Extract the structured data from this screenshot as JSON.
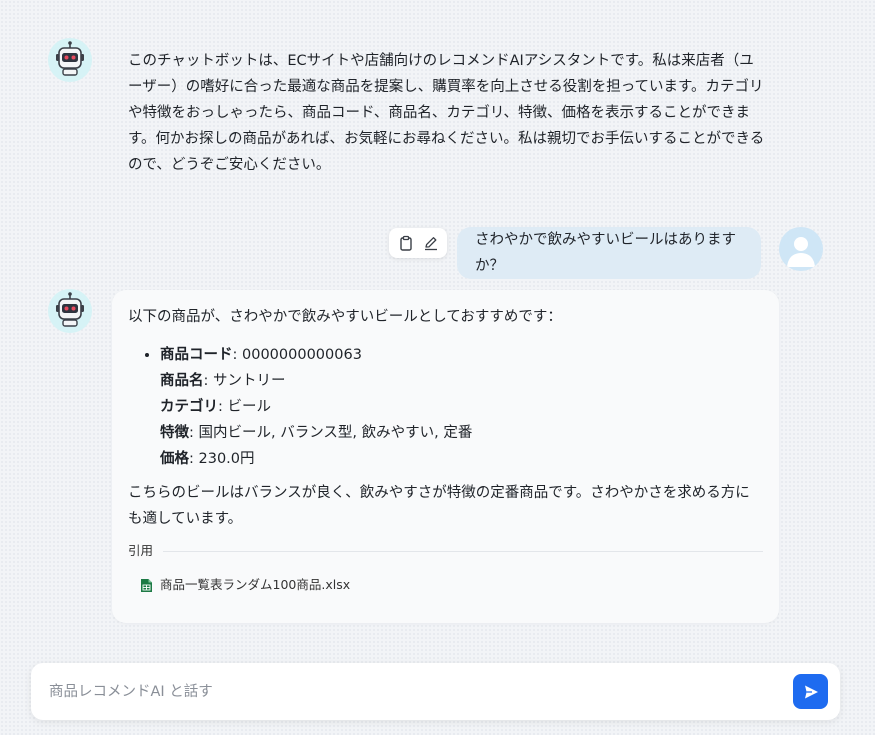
{
  "messages": {
    "bot_intro": "このチャットボットは、ECサイトや店舗向けのレコメンドAIアシスタントです。私は来店者（ユーザー）の嗜好に合った最適な商品を提案し、購買率を向上させる役割を担っています。カテゴリや特徴をおっしゃったら、商品コード、商品名、カテゴリ、特徴、価格を表示することができます。何かお探しの商品があれば、お気軽にお尋ねください。私は親切でお手伝いすることができるので、どうぞご安心ください。",
    "user_question": "さわやかで飲みやすいビールはありますか？",
    "bot_reply": {
      "intro": "以下の商品が、さわやかで飲みやすいビールとしておすすめです：",
      "product": {
        "code_label": "商品コード",
        "code": ": 0000000000063",
        "name_label": "商品名",
        "name": ": サントリー",
        "category_label": "カテゴリ",
        "category": ": ビール",
        "features_label": "特徴",
        "features": ": 国内ビール, バランス型, 飲みやすい, 定番",
        "price_label": "価格",
        "price": ": 230.0円"
      },
      "outro": "こちらのビールはバランスが良く、飲みやすさが特徴の定番商品です。さわやかさを求める方にも適しています。",
      "citation_label": "引用",
      "citation_file": "商品一覧表ランダム100商品.xlsx"
    }
  },
  "composer": {
    "placeholder": "商品レコメンドAI と話す"
  },
  "icons": {
    "bot_avatar": "robot-icon",
    "user_avatar": "user-icon",
    "copy": "clipboard-icon",
    "edit": "pencil-icon",
    "file": "excel-file-icon",
    "send": "send-icon"
  },
  "colors": {
    "accent": "#1e6bf0",
    "user_bubble": "#deebf5",
    "bot_avatar_bg": "#d6f3f6",
    "excel_green": "#1d7a45"
  }
}
